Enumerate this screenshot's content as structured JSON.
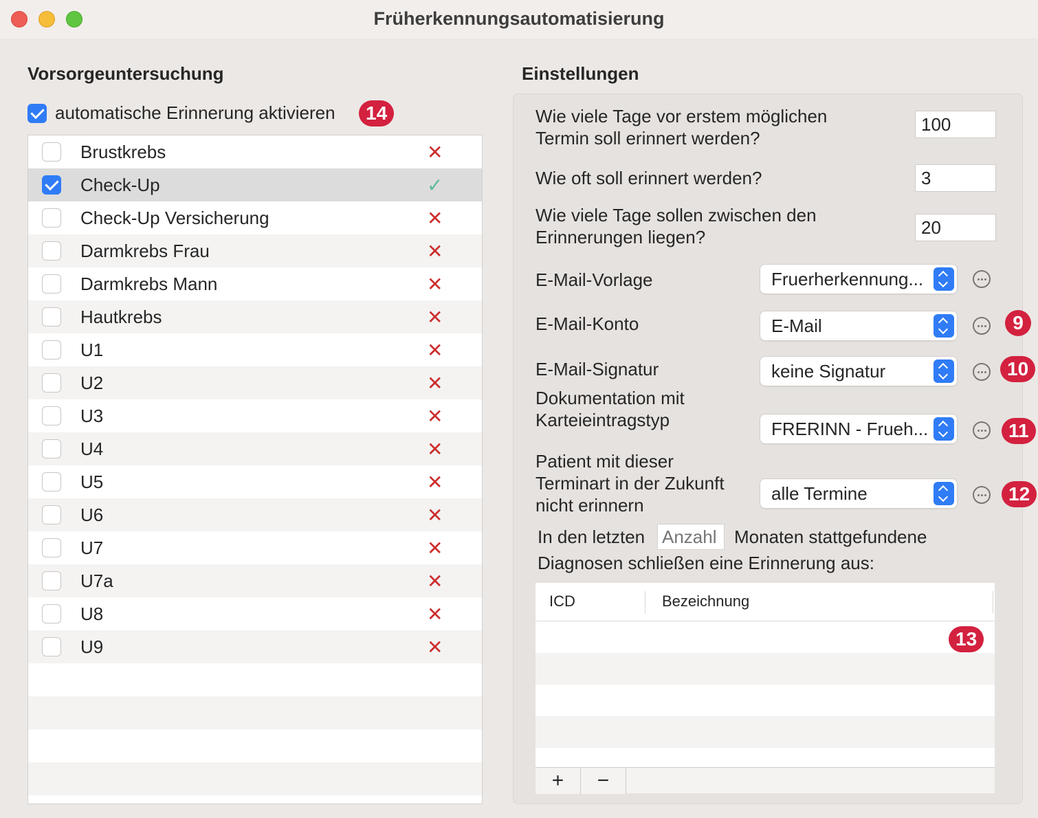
{
  "window": {
    "title": "Früherkennungsautomatisierung"
  },
  "left": {
    "heading": "Vorsorgeuntersuchung",
    "auto_reminder": {
      "label": "automatische Erinnerung aktivieren",
      "checked": true,
      "badge": "14"
    },
    "items": [
      {
        "label": "Brustkrebs",
        "checked": false,
        "status": "✕"
      },
      {
        "label": "Check-Up",
        "checked": true,
        "status": "✓"
      },
      {
        "label": "Check-Up Versicherung",
        "checked": false,
        "status": "✕"
      },
      {
        "label": "Darmkrebs Frau",
        "checked": false,
        "status": "✕"
      },
      {
        "label": "Darmkrebs Mann",
        "checked": false,
        "status": "✕"
      },
      {
        "label": "Hautkrebs",
        "checked": false,
        "status": "✕"
      },
      {
        "label": "U1",
        "checked": false,
        "status": "✕"
      },
      {
        "label": "U2",
        "checked": false,
        "status": "✕"
      },
      {
        "label": "U3",
        "checked": false,
        "status": "✕"
      },
      {
        "label": "U4",
        "checked": false,
        "status": "✕"
      },
      {
        "label": "U5",
        "checked": false,
        "status": "✕"
      },
      {
        "label": "U6",
        "checked": false,
        "status": "✕"
      },
      {
        "label": "U7",
        "checked": false,
        "status": "✕"
      },
      {
        "label": "U7a",
        "checked": false,
        "status": "✕"
      },
      {
        "label": "U8",
        "checked": false,
        "status": "✕"
      },
      {
        "label": "U9",
        "checked": false,
        "status": "✕"
      }
    ]
  },
  "right": {
    "heading": "Einstellungen",
    "q_days_before": {
      "line1": "Wie viele Tage vor erstem möglichen",
      "line2": "Termin soll erinnert werden?",
      "value": "100"
    },
    "q_how_often": {
      "label": "Wie oft soll erinnert werden?",
      "value": "3"
    },
    "q_days_between": {
      "line1": "Wie viele Tage sollen zwischen den",
      "line2": "Erinnerungen liegen?",
      "value": "20"
    },
    "email_template": {
      "label": "E-Mail-Vorlage",
      "value": "Fruerherkennung..."
    },
    "email_account": {
      "label": "E-Mail-Konto",
      "value": "E-Mail",
      "badge": "9"
    },
    "email_signature": {
      "label": "E-Mail-Signatur",
      "value": "keine Signatur",
      "badge": "10"
    },
    "documentation": {
      "line1": "Dokumentation mit",
      "line2": "Karteieintragstyp",
      "value": "FRERINN - Frueh...",
      "badge": "11"
    },
    "appointment_type": {
      "line1": "Patient mit dieser",
      "line2": "Terminart in der Zukunft",
      "line3": "nicht erinnern",
      "value": "alle Termine",
      "badge": "12"
    },
    "diagnoses": {
      "prefix": "In den letzten",
      "placeholder": "Anzahl",
      "suffix": "Monaten stattgefundene",
      "line2": "Diagnosen schließen eine Erinnerung aus:",
      "columns": [
        "ICD",
        "Bezeichnung"
      ],
      "badge": "13",
      "add_label": "+",
      "remove_label": "−"
    }
  },
  "colors": {
    "accent": "#2f7cf6",
    "badge": "#d3213f",
    "cross": "#cc2d2d",
    "check": "#5fb99a"
  }
}
